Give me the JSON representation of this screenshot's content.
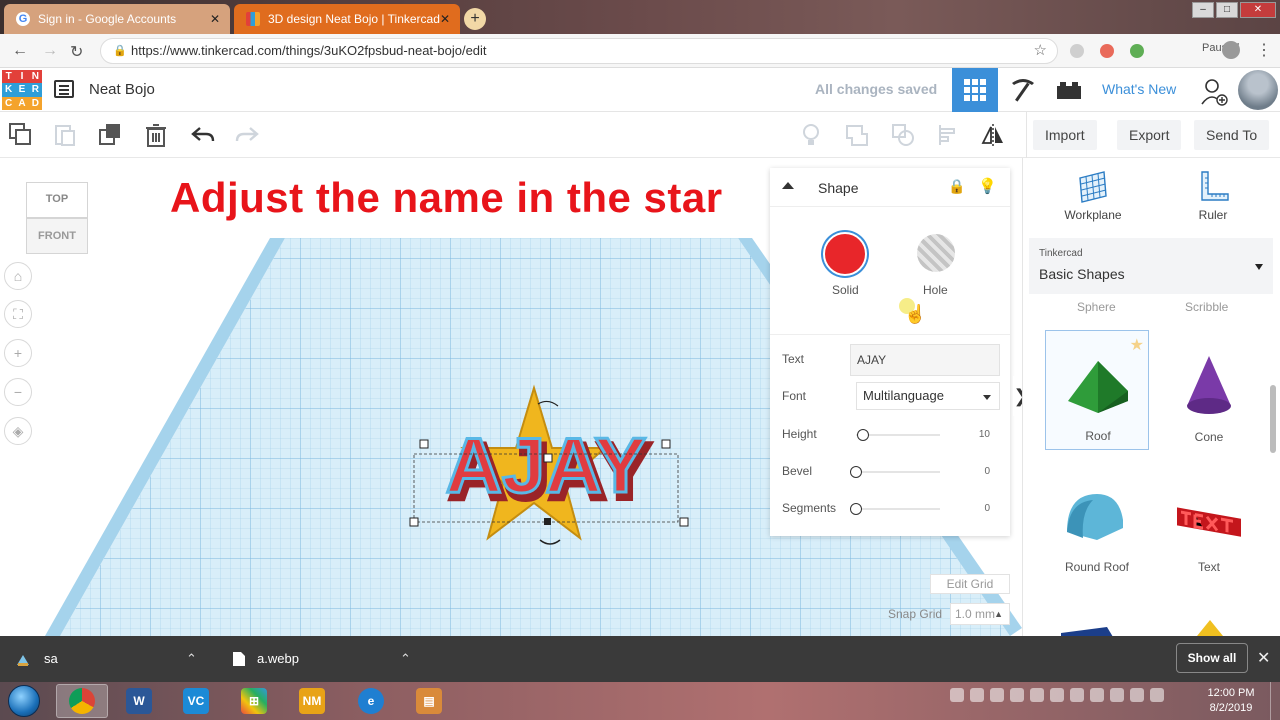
{
  "browser": {
    "tabs": [
      {
        "label": "Sign in - Google Accounts",
        "active": false
      },
      {
        "label": "3D design Neat Bojo | Tinkercad",
        "active": true
      }
    ],
    "url": "https://www.tinkercad.com/things/3uKO2fpsbud-neat-bojo/edit",
    "profile_status": "Paused"
  },
  "header": {
    "logo_letters": [
      "T",
      "I",
      "N",
      "K",
      "E",
      "R",
      "C",
      "A",
      "D"
    ],
    "logo_colors": [
      "#e2403a",
      "#e2403a",
      "#e2403a",
      "#2f9ed8",
      "#2f9ed8",
      "#2f9ed8",
      "#f4a32c",
      "#f4a32c",
      "#f4a32c"
    ],
    "design_title": "Neat Bojo",
    "save_status": "All changes saved",
    "whats_new": "What's New",
    "accent": "#3b8fd9"
  },
  "toolbar": {
    "import": "Import",
    "export": "Export",
    "send_to": "Send To"
  },
  "workplane": {
    "instruction": "Adjust the name in the star",
    "viewcube_top": "TOP",
    "viewcube_front": "FRONT",
    "model_text": "AJAY",
    "edit_grid": "Edit Grid",
    "snap_grid_label": "Snap Grid",
    "snap_grid_value": "1.0 mm"
  },
  "inspector": {
    "title": "Shape",
    "solid_label": "Solid",
    "hole_label": "Hole",
    "solid_color": "#e8262a",
    "text_label": "Text",
    "text_value": "AJAY",
    "font_label": "Font",
    "font_value": "Multilanguage",
    "height_label": "Height",
    "height_value": "10",
    "bevel_label": "Bevel",
    "bevel_value": "0",
    "segments_label": "Segments",
    "segments_value": "0"
  },
  "right_panel": {
    "workplane_label": "Workplane",
    "ruler_label": "Ruler",
    "library_caption": "Tinkercad",
    "library_value": "Basic Shapes",
    "cut_labels": [
      "Sphere",
      "Scribble"
    ],
    "shapes": [
      {
        "label": "Roof",
        "selected": true
      },
      {
        "label": "Cone",
        "selected": false
      },
      {
        "label": "Round Roof",
        "selected": false
      },
      {
        "label": "Text",
        "selected": false
      }
    ]
  },
  "downloads": {
    "items": [
      "sa",
      "a.webp"
    ],
    "show_all": "Show all"
  },
  "taskbar": {
    "time": "12:00 PM",
    "date": "8/2/2019"
  }
}
